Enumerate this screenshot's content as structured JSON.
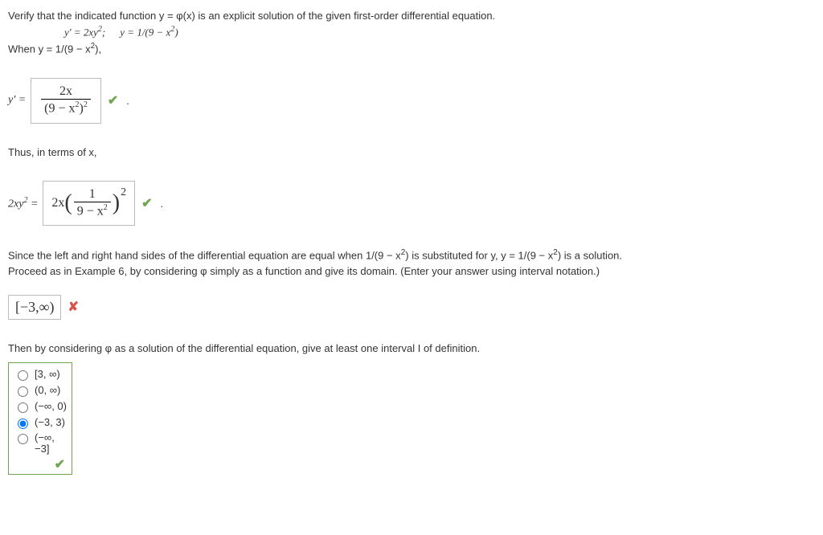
{
  "q": {
    "intro": "Verify that the indicated function y = φ(x) is an explicit solution of the given first-order differential equation.",
    "eq_left": "y' = 2xy",
    "eq_left_sup": "2",
    "eq_sep": ";",
    "eq_right_pre": "y = 1/(9 − x",
    "eq_right_sup": "2",
    "eq_right_post": ")",
    "when_pre": "When y = 1/(9 − x",
    "when_sup": "2",
    "when_post": "),"
  },
  "ans1": {
    "lhs": "y' =",
    "num": "2x",
    "den_pre": "(9 − x",
    "den_sup": "2",
    "den_post": ")",
    "outer_exp": "2",
    "dot": "."
  },
  "thus": "Thus, in terms of x,",
  "ans2": {
    "lhs_pre": "2xy",
    "lhs_sup": "2",
    "lhs_post": " =",
    "coeff": "2x",
    "inner_num": "1",
    "inner_den_pre": "9 − x",
    "inner_den_sup": "2",
    "outer_exp": "2",
    "dot": "."
  },
  "since_pre": "Since the left and right hand sides of the differential equation are equal when 1/(9 − x",
  "since_sup1": "2",
  "since_mid": ") is substituted for y, y = 1/(9 − x",
  "since_sup2": "2",
  "since_post": ") is a solution.",
  "proceed": "Proceed as in Example 6, by considering φ simply as a function and give its domain. (Enter your answer using interval notation.)",
  "domain_answer": "[−3,∞)",
  "then": "Then by considering φ as a solution of the differential equation, give at least one interval I of definition.",
  "choices": [
    {
      "label": "[3, ∞)",
      "selected": false
    },
    {
      "label": "(0, ∞)",
      "selected": false
    },
    {
      "label": "(−∞, 0)",
      "selected": false
    },
    {
      "label": "(−3, 3)",
      "selected": true
    },
    {
      "label": "(−∞, −3]",
      "selected": false
    }
  ]
}
